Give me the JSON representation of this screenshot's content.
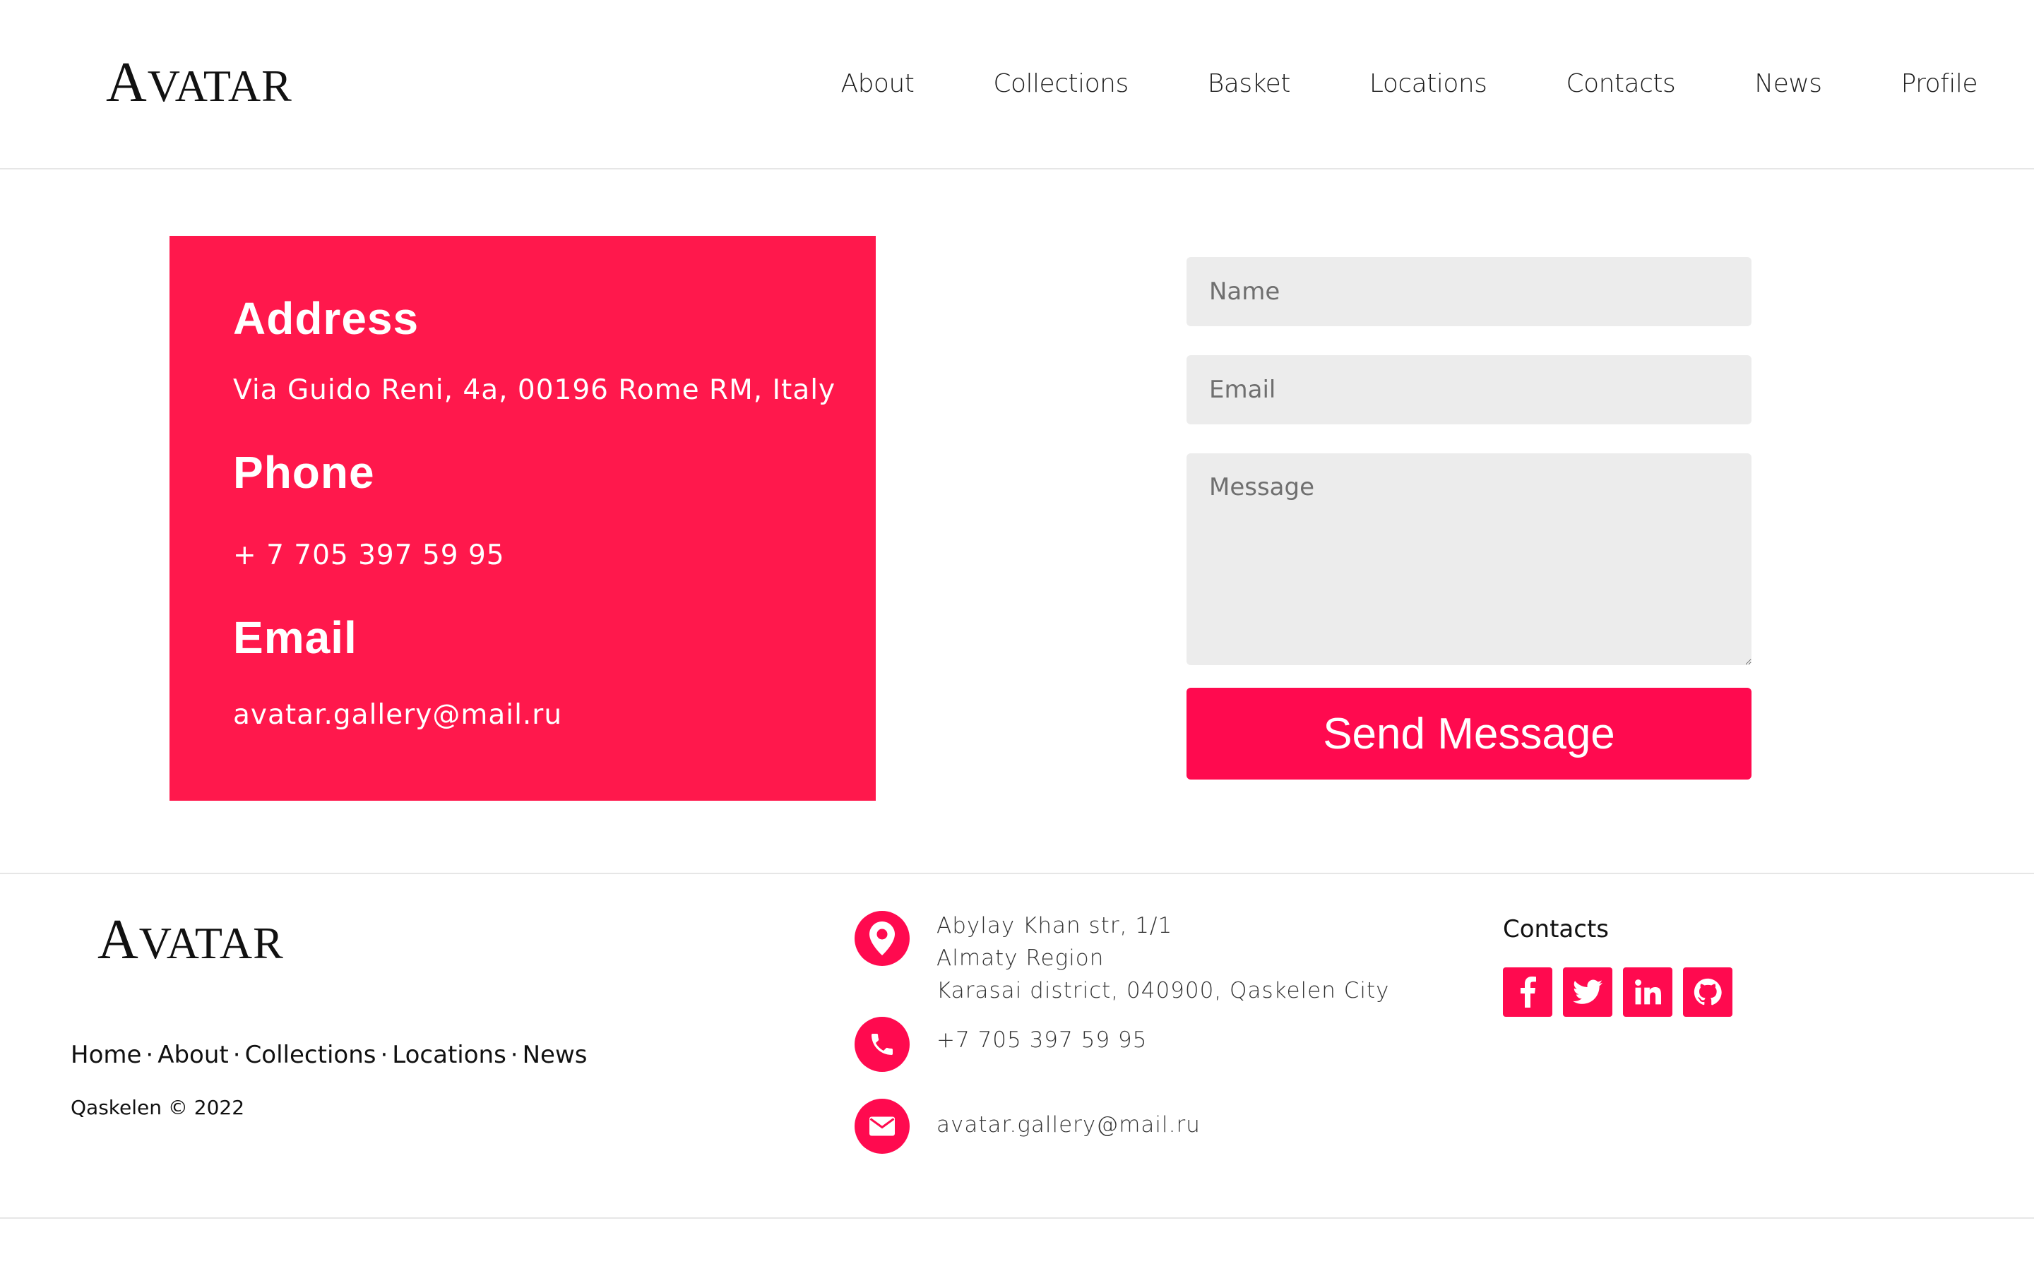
{
  "header": {
    "logo_big": "A",
    "logo_small": "VATAR",
    "nav": [
      "About",
      "Collections",
      "Basket",
      "Locations",
      "Contacts",
      "News",
      "Profile"
    ]
  },
  "card": {
    "address_title": "Address",
    "address_value": "Via Guido Reni, 4a, 00196 Rome RM, Italy",
    "phone_title": "Phone",
    "phone_value": "+ 7 705 397 59 95",
    "email_title": "Email",
    "email_value": "avatar.gallery@mail.ru"
  },
  "form": {
    "name_placeholder": "Name",
    "email_placeholder": "Email",
    "message_placeholder": "Message",
    "send_label": "Send Message"
  },
  "footer": {
    "logo_big": "A",
    "logo_small": "VATAR",
    "links": [
      "Home",
      "About",
      "Collections",
      "Locations",
      "News"
    ],
    "link_separator": "·",
    "copyright": "Qaskelen © 2022",
    "address_lines": [
      "Abylay Khan str, 1/1",
      "Almaty Region",
      "Karasai district, 040900, Qaskelen City"
    ],
    "phone": "+7 705 397 59 95",
    "email": "avatar.gallery@mail.ru",
    "contacts_title": "Contacts",
    "social": [
      "facebook-icon",
      "twitter-icon",
      "linkedin-icon",
      "github-icon"
    ]
  },
  "colors": {
    "accent": "#ff0a4f",
    "card": "#ff184c",
    "field_bg": "#ececec"
  }
}
